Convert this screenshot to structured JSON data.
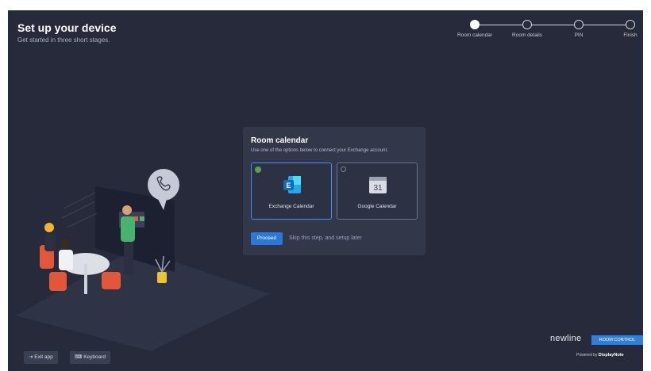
{
  "header": {
    "title": "Set up your device",
    "subtitle": "Get started in three short stages."
  },
  "stepper": [
    {
      "label": "Room calendar",
      "state": "active"
    },
    {
      "label": "Room details",
      "state": "pending"
    },
    {
      "label": "PIN",
      "state": "pending"
    },
    {
      "label": "Finish",
      "state": "pending"
    }
  ],
  "card": {
    "title": "Room calendar",
    "description": "Use one of the options below to connect your Exchange account.",
    "options": [
      {
        "label": "Exchange Calendar",
        "icon": "exchange-icon",
        "selected": true
      },
      {
        "label": "Google Calendar",
        "icon": "google-calendar-icon",
        "selected": false,
        "icon_text": "31"
      }
    ],
    "proceed_label": "Proceed",
    "skip_text": "Skip this step, and setup later"
  },
  "footer": {
    "exit_label": "Exit app",
    "keyboard_label": "Keyboard",
    "brand": "newline",
    "brand_tag": "ROOM CONTROL",
    "powered_prefix": "Powered by",
    "powered_brand": "DisplayNote"
  },
  "colors": {
    "background": "#262a3a",
    "card": "#32374a",
    "accent": "#2a78d9",
    "check": "#5aa05a"
  }
}
